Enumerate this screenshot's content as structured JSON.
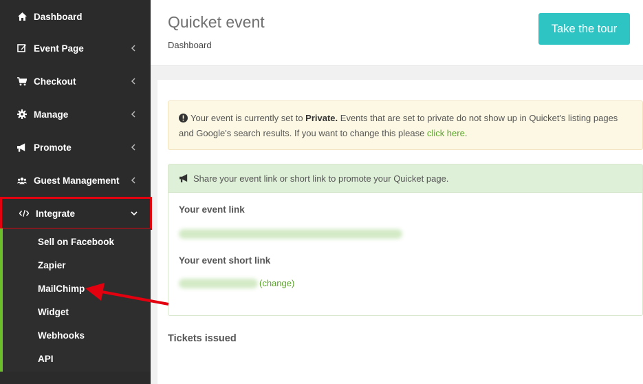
{
  "sidebar": {
    "items": [
      {
        "label": "Dashboard",
        "icon": "home-icon"
      },
      {
        "label": "Event Page",
        "icon": "edit-icon"
      },
      {
        "label": "Checkout",
        "icon": "cart-icon"
      },
      {
        "label": "Manage",
        "icon": "gear-icon"
      },
      {
        "label": "Promote",
        "icon": "megaphone-icon"
      },
      {
        "label": "Guest Management",
        "icon": "users-icon"
      },
      {
        "label": "Integrate",
        "icon": "code-icon"
      }
    ],
    "submenu": [
      "Sell on Facebook",
      "Zapier",
      "MailChimp",
      "Widget",
      "Webhooks",
      "API"
    ]
  },
  "header": {
    "title": "Quicket event",
    "breadcrumb": "Dashboard",
    "tour_button": "Take the tour"
  },
  "alert": {
    "prefix": "Your event is currently set to ",
    "status": "Private.",
    "body": " Events that are set to private do not show up in Quicket's listing pages and Google's search results. If you want to change this please ",
    "link": "click here",
    "suffix": "."
  },
  "share_panel": {
    "heading": "Share your event link or short link to promote your Quicket page.",
    "event_link_label": "Your event link",
    "short_link_label": "Your event short link",
    "change_label": "(change)"
  },
  "tickets": {
    "title": "Tickets issued"
  },
  "colors": {
    "sidebar_bg": "#2b2b2b",
    "accent_teal": "#2ec4c4",
    "highlight_red": "#e3000f",
    "active_green": "#6cbf2a"
  }
}
